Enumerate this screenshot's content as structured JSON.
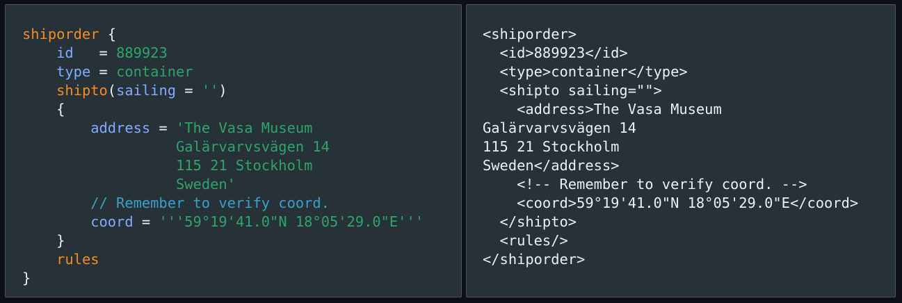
{
  "sdl_panel": {
    "line1": {
      "element": "shiporder",
      "brace": " {"
    },
    "line2": {
      "indent": "    ",
      "attr": "id",
      "eq": "   = ",
      "value": "889923"
    },
    "line3": {
      "indent": "    ",
      "attr": "type",
      "eq": " = ",
      "value": "container"
    },
    "line4": {
      "indent": "    ",
      "element": "shipto",
      "open": "(",
      "attr": "sailing",
      "eq": " = ",
      "value": "''",
      "close": ")"
    },
    "line5": {
      "indent": "    ",
      "brace": "{"
    },
    "line6": {
      "indent": "        ",
      "attr": "address",
      "eq": " = ",
      "value": "'The Vasa Museum"
    },
    "line7": {
      "indent": "                  ",
      "value": "Galärvarvsvägen 14"
    },
    "line8": {
      "indent": "                  ",
      "value": "115 21 Stockholm"
    },
    "line9": {
      "indent": "                  ",
      "value": "Sweden'"
    },
    "line10": {
      "indent": "        ",
      "comment": "// Remember to verify coord."
    },
    "line11": {
      "indent": "        ",
      "attr": "coord",
      "eq": " = ",
      "value": "'''59°19'41.0\"N 18°05'29.0\"E'''"
    },
    "line12": {
      "indent": "    ",
      "brace": "}"
    },
    "line13": {
      "indent": "    ",
      "element": "rules"
    },
    "line14": {
      "brace": "}"
    }
  },
  "xml_panel": {
    "lines": [
      "<shiporder>",
      "  <id>889923</id>",
      "  <type>container</type>",
      "  <shipto sailing=\"\">",
      "    <address>The Vasa Museum",
      "Galärvarvsvägen 14",
      "115 21 Stockholm",
      "Sweden</address>",
      "    <!-- Remember to verify coord. -->",
      "    <coord>59°19'41.0\"N 18°05'29.0\"E</coord>",
      "  </shipto>",
      "  <rules/>",
      "</shiporder>"
    ]
  },
  "colors": {
    "background": "#0d1117",
    "panel": "#263238",
    "element": "#f78c1c",
    "attribute": "#82aaff",
    "string": "#2ea36a",
    "comment": "#39a0c8",
    "text": "#eceff1"
  }
}
